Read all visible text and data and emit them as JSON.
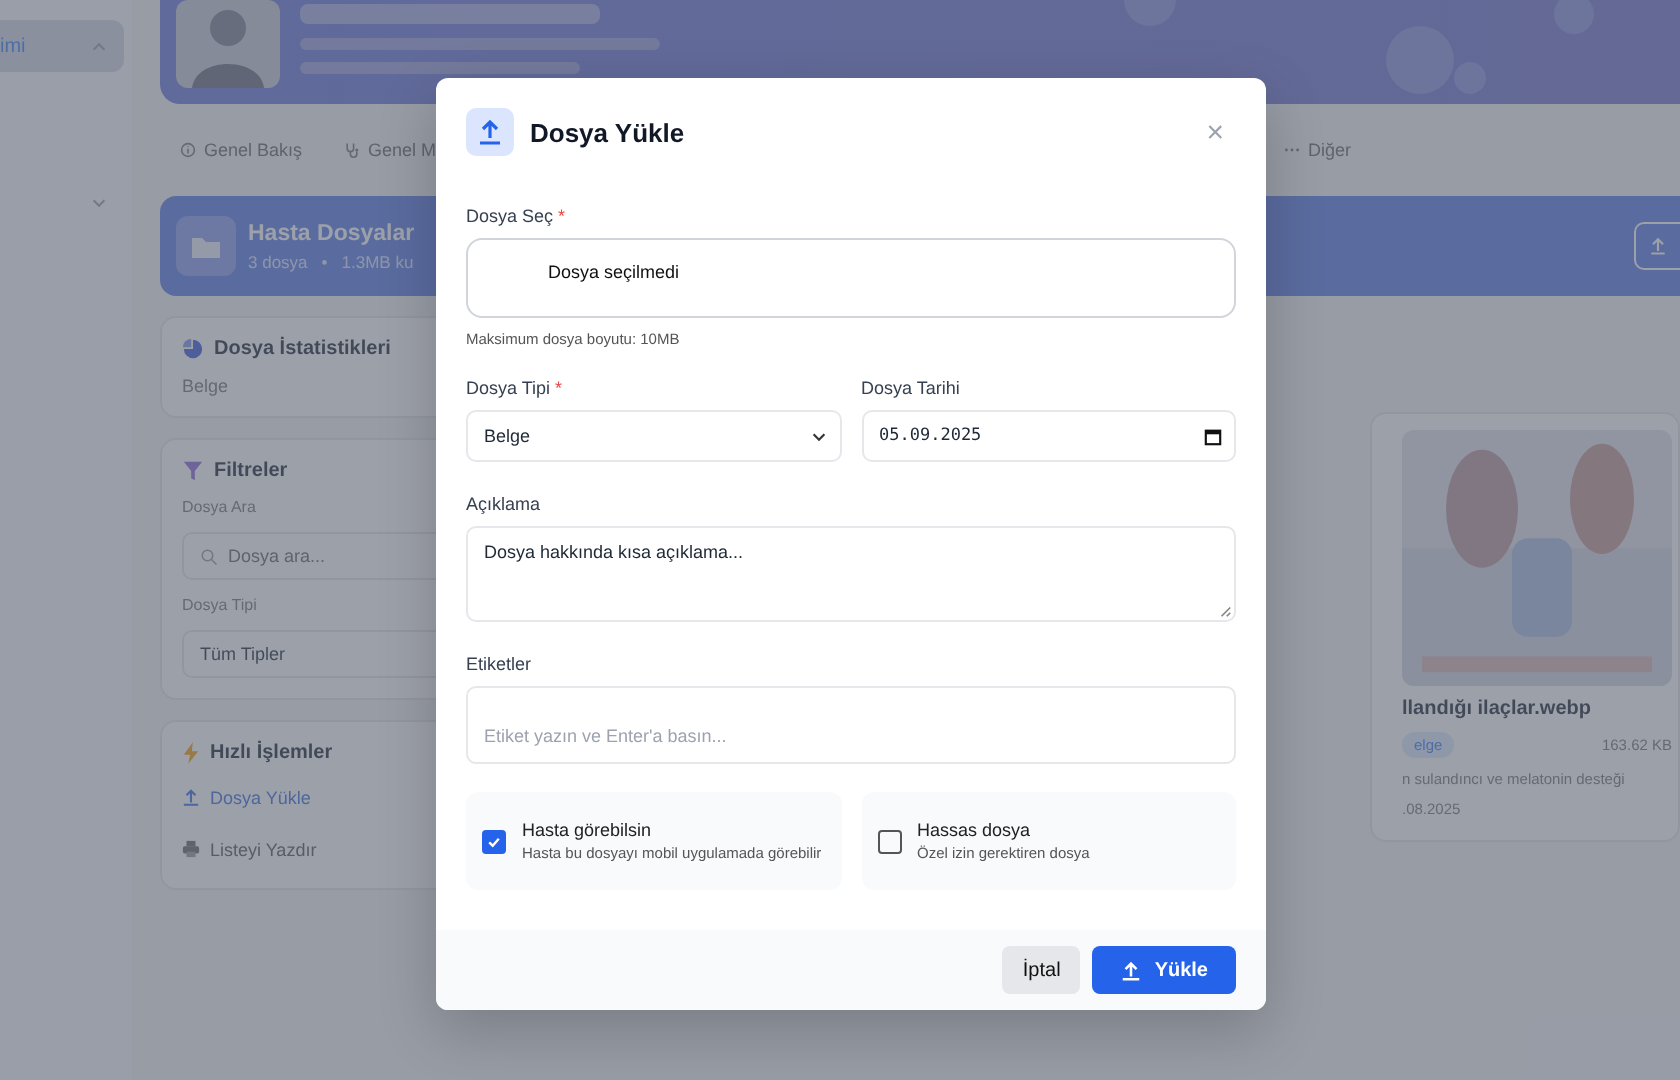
{
  "sidebar": {
    "items": [
      {
        "label": "imi",
        "selected": true,
        "expanded": true
      },
      {
        "selected": false,
        "expanded": false
      }
    ]
  },
  "tabs": [
    {
      "label": "Genel Bakış"
    },
    {
      "label": "Genel M"
    },
    {
      "label": "Diğer"
    }
  ],
  "files_header": {
    "title": "Hasta Dosyalar",
    "count": "3 dosya",
    "separator": "•",
    "size": "1.3MB ku"
  },
  "stats_card": {
    "title": "Dosya İstatistikleri",
    "items": [
      "Belge"
    ]
  },
  "filters": {
    "title": "Filtreler",
    "search_label": "Dosya Ara",
    "search_placeholder": "Dosya ara...",
    "type_label": "Dosya Tipi",
    "type_value": "Tüm Tipler"
  },
  "quick_actions": {
    "title": "Hızlı İşlemler",
    "items": [
      {
        "label": "Dosya Yükle",
        "kind": "primary"
      },
      {
        "label": "Listeyi Yazdır",
        "kind": "default"
      }
    ]
  },
  "file_card": {
    "kind": "picture",
    "name": "llandığı ilaçlar.webp",
    "tag": "elge",
    "size": "163.62 KB",
    "description": "n sulandıncı ve melatonin desteği",
    "date": ".08.2025"
  },
  "modal": {
    "title": "Dosya Yükle",
    "close": "×",
    "file_field": {
      "label": "Dosya Seç",
      "required_mark": "*",
      "value": "Dosya seçilmedi",
      "hint": "Maksimum dosya boyutu: 10MB"
    },
    "type_field": {
      "label": "Dosya Tipi",
      "required_mark": "*",
      "value": "Belge"
    },
    "date_field": {
      "label": "Dosya Tarihi",
      "value": "05.09.2025"
    },
    "description_field": {
      "label": "Açıklama",
      "value": "Dosya hakkında kısa açıklama..."
    },
    "tags_field": {
      "label": "Etiketler",
      "placeholder": "Etiket yazın ve Enter'a basın..."
    },
    "options": [
      {
        "title": "Hasta görebilsin",
        "description": "Hasta bu dosyayı mobil uygulamada görebilir",
        "checked": true
      },
      {
        "title": "Hassas dosya",
        "description": "Özel izin gerektiren dosya",
        "checked": false
      }
    ],
    "buttons": [
      {
        "label": "İptal",
        "kind": "secondary"
      },
      {
        "label": "Yükle",
        "kind": "primary"
      }
    ]
  }
}
